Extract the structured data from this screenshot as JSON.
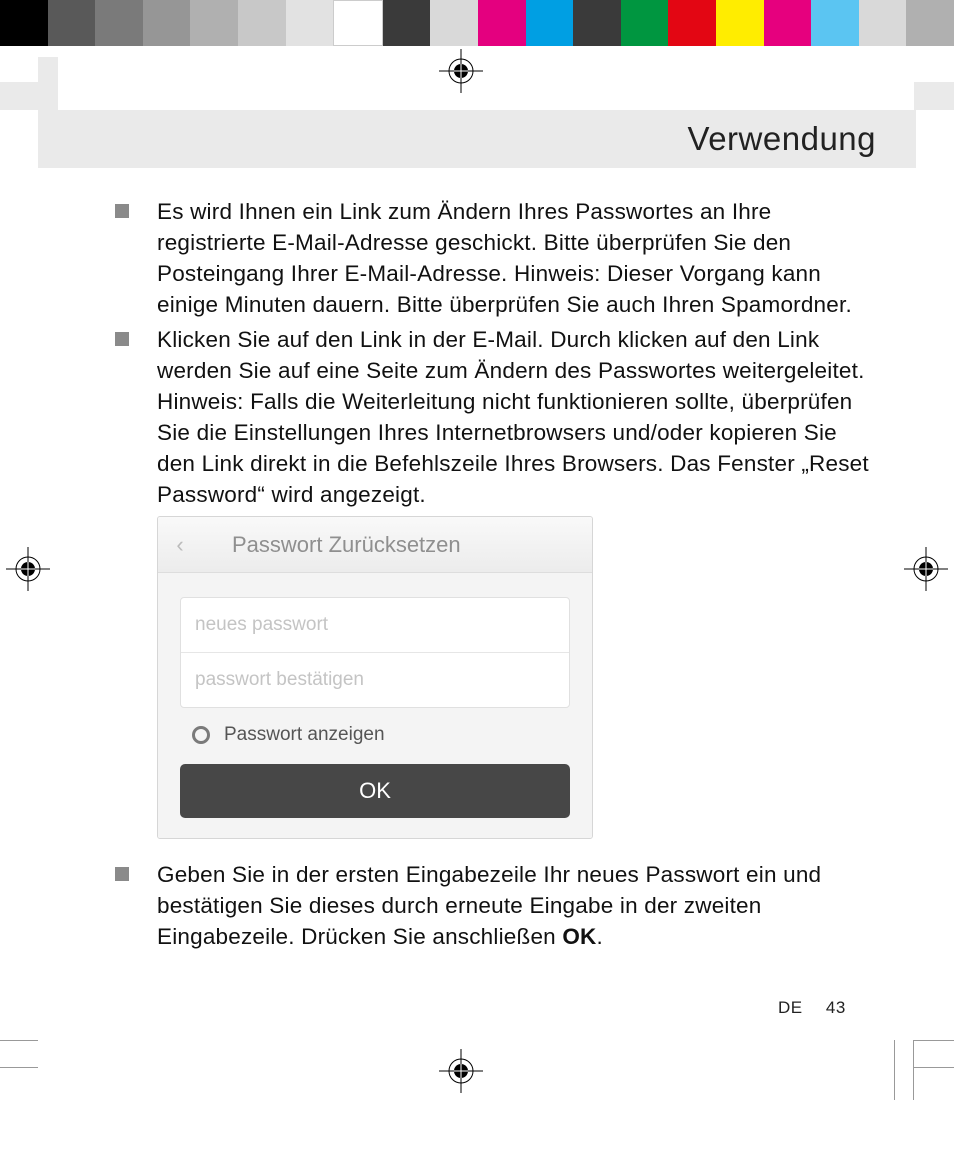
{
  "colorbar": [
    "#000000",
    "#595959",
    "#7a7a7a",
    "#969696",
    "#b0b0b0",
    "#c8c8c8",
    "#e2e2e2",
    "#ffffff",
    "#3a3a3a",
    "#d9d9d9",
    "#e4007f",
    "#009fe3",
    "#3a3a3a",
    "#009640",
    "#e30613",
    "#ffed00",
    "#e6007e",
    "#5bc5f2",
    "#d9d9d9",
    "#b0b0b0"
  ],
  "header": {
    "title": "Verwendung"
  },
  "bullets": {
    "b1": "Es wird Ihnen ein Link zum Ändern Ihres Passwortes an Ihre registrierte E-Mail-Adresse geschickt. Bitte überprüfen Sie den Posteingang Ihrer E-Mail-Adresse. Hinweis: Dieser Vorgang kann einige Minuten dauern. Bitte überprüfen Sie auch Ihren Spamordner.",
    "b2": "Klicken Sie auf den Link in der E-Mail. Durch klicken auf den Link werden Sie auf eine Seite zum Ändern des Passwortes weitergeleitet. Hinweis: Falls die Weiterleitung nicht funktionieren sollte, überprüfen Sie die Einstellungen Ihres Internetbrowsers und/oder kopieren Sie den Link direkt in die Befehlszeile Ihres Browsers. Das Fenster „Reset Password“ wird angezeigt.",
    "b3_pre": "Geben Sie in der ersten Eingabezeile Ihr neues Passwort ein und bestätigen Sie dieses durch erneute Eingabe in der zweiten Eingabezeile. Drücken Sie anschließen ",
    "b3_bold": "OK",
    "b3_post": "."
  },
  "screenshot": {
    "back": "‹",
    "title": "Passwort Zurücksetzen",
    "input1": "neues passwort",
    "input2": "passwort bestätigen",
    "showpw": "Passwort anzeigen",
    "ok": "OK"
  },
  "footer": {
    "lang": "DE",
    "page": "43"
  }
}
